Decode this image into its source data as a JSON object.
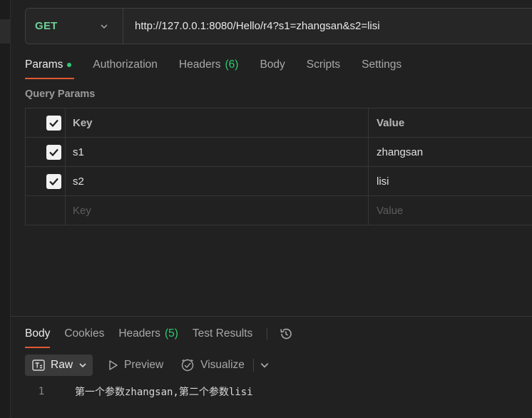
{
  "request": {
    "method": "GET",
    "url": "http://127.0.0.1:8080/Hello/r4?s1=zhangsan&s2=lisi"
  },
  "tabs": [
    {
      "label": "Params"
    },
    {
      "label": "Authorization"
    },
    {
      "label": "Headers",
      "count": "(6)"
    },
    {
      "label": "Body"
    },
    {
      "label": "Scripts"
    },
    {
      "label": "Settings"
    }
  ],
  "query_params": {
    "title": "Query Params",
    "headers": {
      "key": "Key",
      "value": "Value"
    },
    "rows": [
      {
        "key": "s1",
        "value": "zhangsan",
        "checked": true
      },
      {
        "key": "s2",
        "value": "lisi",
        "checked": true
      }
    ],
    "placeholder": {
      "key": "Key",
      "value": "Value"
    }
  },
  "response": {
    "tabs": [
      {
        "label": "Body"
      },
      {
        "label": "Cookies"
      },
      {
        "label": "Headers",
        "count": "(5)"
      },
      {
        "label": "Test Results"
      }
    ],
    "toolbar": {
      "format": "Raw",
      "preview": "Preview",
      "visualize": "Visualize"
    },
    "lines": [
      {
        "number": "1",
        "text": "第一个参数zhangsan,第二个参数lisi"
      }
    ]
  },
  "colors": {
    "accent": "#e05a33",
    "method": "#6fcf97",
    "count": "#2ecc71"
  }
}
